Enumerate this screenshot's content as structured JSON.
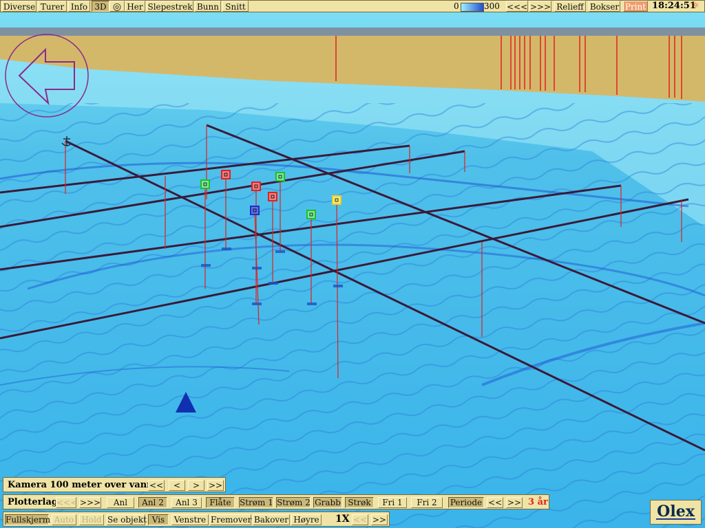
{
  "top_toolbar": {
    "items": [
      "Diverse",
      "Turer",
      "Info",
      "3D",
      "Her",
      "Slepestrek",
      "Bunn",
      "Snitt"
    ],
    "depth_min": "0",
    "depth_max": "300",
    "nav_prev": "<<<",
    "nav_next": ">>>",
    "relief": "Relieff",
    "boxes": "Bokser",
    "print": "Print",
    "time": "18:24:51"
  },
  "camera_panel": {
    "label": "Kamera 100 meter over vann",
    "buttons": [
      "<<",
      "<",
      ">",
      ">>"
    ]
  },
  "plotter_panel": {
    "label": "Plotterlag",
    "prev": "<<<",
    "next": ">>>",
    "layers": [
      "Anl",
      "Anl 2",
      "Anl 3",
      "Flåte",
      "Strøm 1",
      "Strøm 2",
      "Grabb",
      "Strøk",
      "Fri 1",
      "Fri 2",
      "Periode"
    ],
    "period_prev": "<<",
    "period_next": ">>",
    "period_value": "3 år"
  },
  "bottom_panel": {
    "buttons": [
      "Fullskjerm",
      "Auto",
      "Hold",
      "Se objekt",
      "Vis",
      "Venstre",
      "Fremover",
      "Bakover",
      "Høyre"
    ],
    "speed": "1X",
    "speed_prev": "<<",
    "speed_next": ">>"
  },
  "logo": "Olex",
  "colors": {
    "toolbar_bg": "#efe4a6",
    "water": "#5fd0ee",
    "land": "#d4b86a",
    "lines": "#3a1a3a",
    "marker_red": "#e02020",
    "marker_green": "#20c020",
    "marker_yellow": "#e8d020",
    "marker_blue": "#2030c0"
  }
}
